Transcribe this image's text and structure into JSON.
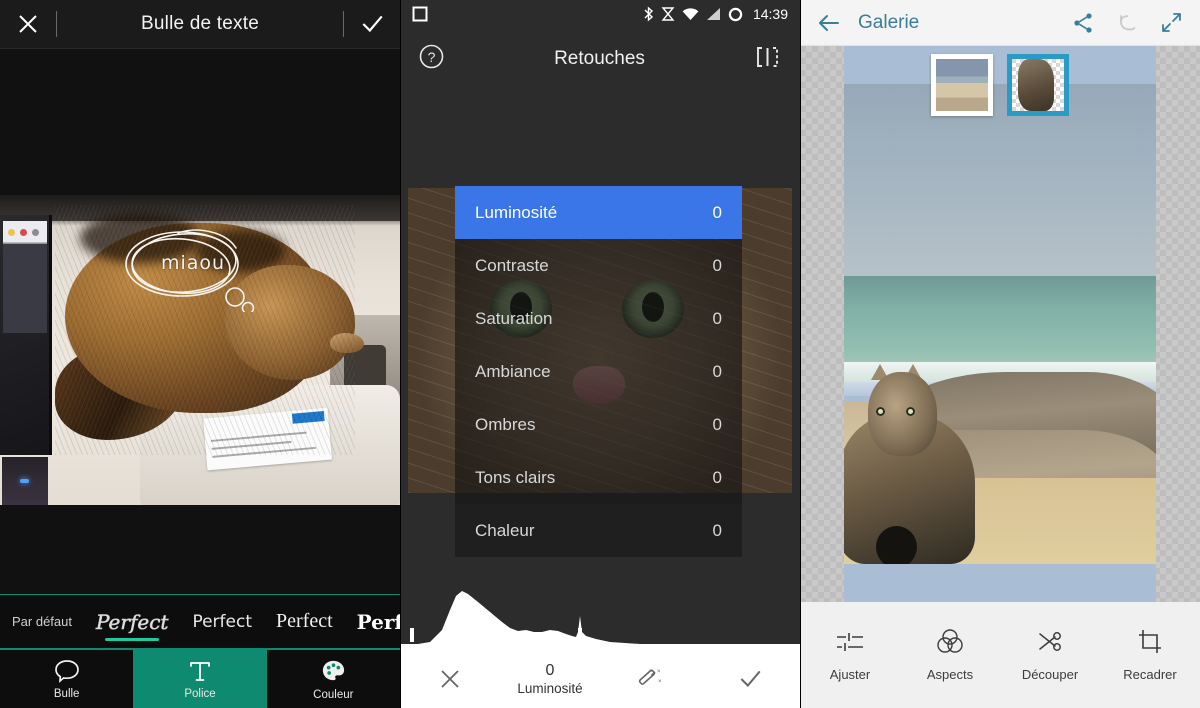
{
  "panel_left": {
    "header": {
      "close_icon": "close-icon",
      "title": "Bulle de texte",
      "confirm_icon": "check-icon"
    },
    "photo": {
      "bubble_text": "miaou"
    },
    "font_options": [
      {
        "label": "Par défaut",
        "style": "default",
        "selected": false
      },
      {
        "label": "Perfect",
        "style": "outline",
        "selected": true
      },
      {
        "label": "Perfect",
        "style": "handwriting",
        "selected": false
      },
      {
        "label": "Perfect",
        "style": "serif",
        "selected": false
      },
      {
        "label": "Perfect",
        "style": "bold",
        "selected": false
      }
    ],
    "tabs": [
      {
        "label": "Bulle",
        "icon": "speech-bubble-icon",
        "active": false
      },
      {
        "label": "Police",
        "icon": "text-type-icon",
        "active": true
      },
      {
        "label": "Couleur",
        "icon": "palette-icon",
        "active": false
      }
    ],
    "accent_color": "#0d8a6f"
  },
  "panel_middle": {
    "status_bar": {
      "app_icon": "square-icon",
      "icons": [
        "bluetooth-icon",
        "alarm-icon",
        "wifi-icon",
        "signal-icon",
        "battery-icon"
      ],
      "time": "14:39"
    },
    "header": {
      "help_icon": "help-circle-icon",
      "title": "Retouches",
      "compare_icon": "compare-split-icon"
    },
    "adjustments": [
      {
        "name": "Luminosité",
        "value": "0",
        "selected": true
      },
      {
        "name": "Contraste",
        "value": "0",
        "selected": false
      },
      {
        "name": "Saturation",
        "value": "0",
        "selected": false
      },
      {
        "name": "Ambiance",
        "value": "0",
        "selected": false
      },
      {
        "name": "Ombres",
        "value": "0",
        "selected": false
      },
      {
        "name": "Tons clairs",
        "value": "0",
        "selected": false
      },
      {
        "name": "Chaleur",
        "value": "0",
        "selected": false
      }
    ],
    "bottom_bar": {
      "cancel_icon": "close-icon",
      "value": "0",
      "value_label": "Luminosité",
      "auto_icon": "magic-wand-icon",
      "confirm_icon": "check-icon"
    },
    "selected_color": "#3b76e8"
  },
  "panel_right": {
    "header": {
      "back_icon": "back-arrow-icon",
      "title": "Galerie",
      "share_icon": "share-icon",
      "undo_icon": "undo-icon",
      "expand_icon": "expand-icon"
    },
    "thumbnails": [
      {
        "name": "beach-layer-thumbnail",
        "selected": false
      },
      {
        "name": "cat-cutout-layer-thumbnail",
        "selected": true
      }
    ],
    "tools": [
      {
        "label": "Ajuster",
        "icon": "sliders-icon"
      },
      {
        "label": "Aspects",
        "icon": "venn-circles-icon"
      },
      {
        "label": "Découper",
        "icon": "scissors-icon"
      },
      {
        "label": "Recadrer",
        "icon": "crop-icon"
      }
    ],
    "accent_color": "#3a7e9b",
    "selection_color": "#2a9bc4"
  }
}
